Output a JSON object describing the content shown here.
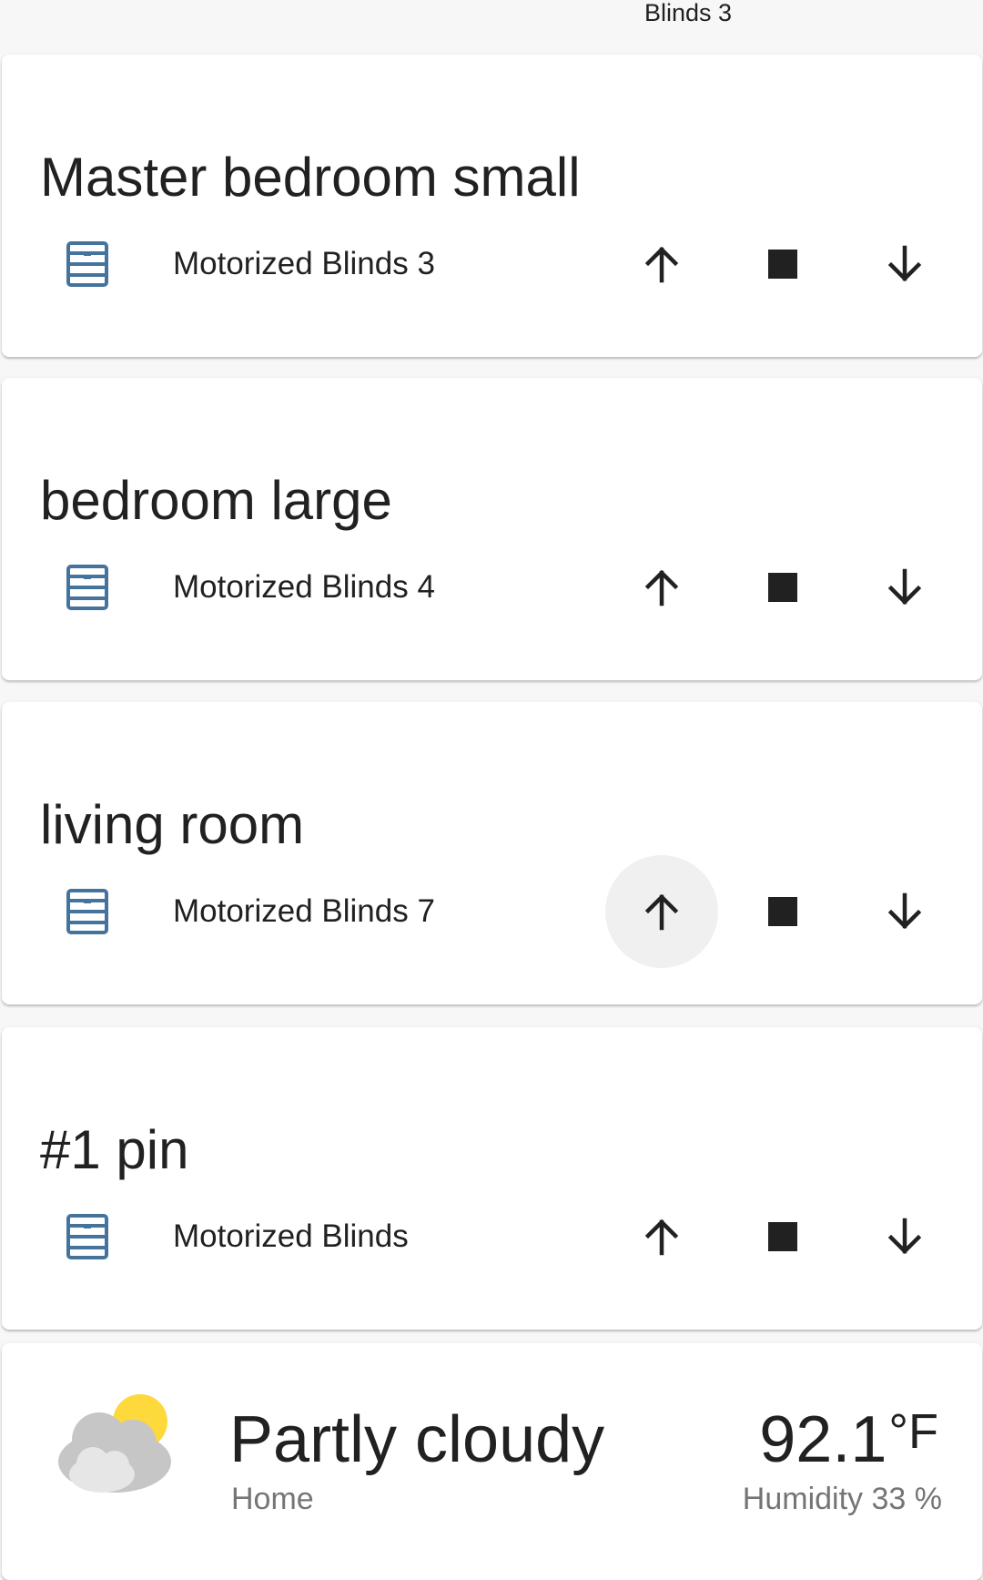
{
  "top": {
    "peek_label": "Blinds 3"
  },
  "cards": [
    {
      "title": "Master bedroom small",
      "entity": "Motorized Blinds 3"
    },
    {
      "title": "bedroom large",
      "entity": "Motorized Blinds 4"
    },
    {
      "title": "living room",
      "entity": "Motorized Blinds 7"
    },
    {
      "title": "#1 pin",
      "entity": "Motorized Blinds"
    }
  ],
  "icons": {
    "entity": "window-shutter-icon",
    "open": "arrow-up-icon",
    "stop": "stop-icon",
    "close": "arrow-down-icon",
    "weather": "partly-cloudy-icon"
  },
  "weather": {
    "state": "Partly cloudy",
    "name": "Home",
    "temperature": "92.1",
    "unit": "°F",
    "humidity": "Humidity 33 %"
  },
  "colors": {
    "entity_icon": "#44739e",
    "sun": "#fdd93c",
    "cloud_back": "#c6c6c6",
    "cloud_front": "#e6e6e6",
    "hover_circle": "#f0f0f0"
  }
}
